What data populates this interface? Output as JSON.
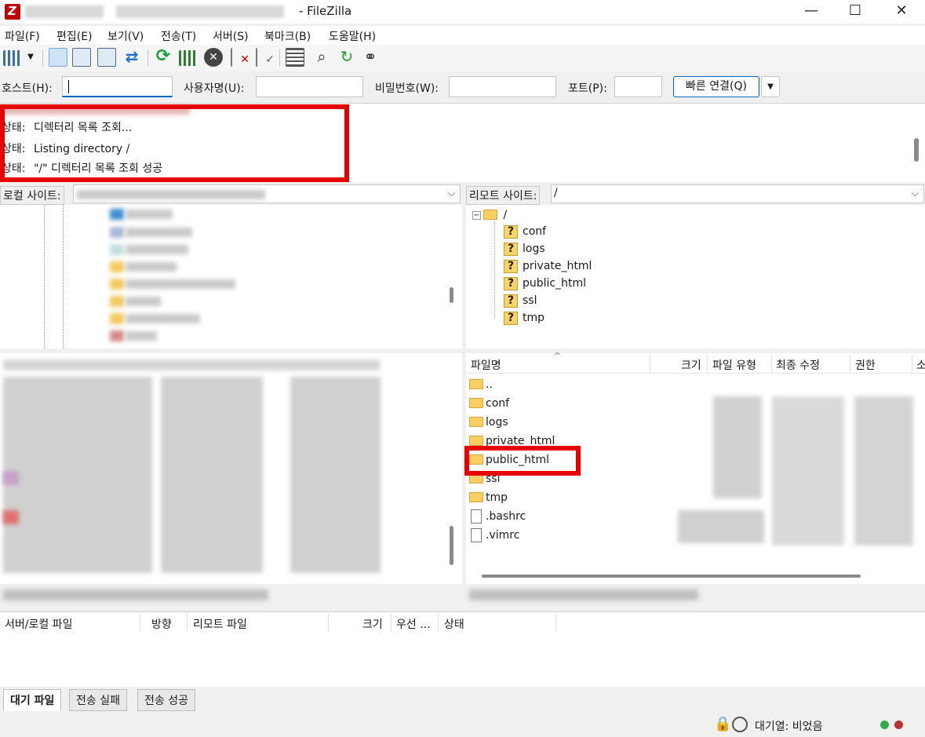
{
  "window": {
    "title": "- FileZilla",
    "controls": {
      "minimize": "—",
      "maximize": "☐",
      "close": "✕"
    }
  },
  "menu": [
    "파일(F)",
    "편집(E)",
    "보기(V)",
    "전송(T)",
    "서버(S)",
    "북마크(B)",
    "도움말(H)"
  ],
  "toolbar_icons": [
    "site-manager-icon",
    "dropdown-arrow-icon",
    "toggle-log-icon",
    "toggle-local-tree-icon",
    "toggle-remote-tree-icon",
    "toggle-queue-icon",
    "refresh-icon",
    "process-queue-icon",
    "cancel-icon",
    "disconnect-icon",
    "reconnect-icon",
    "directory-listing-filter-icon",
    "compare-icon",
    "sync-browse-icon",
    "search-icon"
  ],
  "quickconnect": {
    "host_label": "호스트(H):",
    "user_label": "사용자명(U):",
    "pass_label": "비밀번호(W):",
    "port_label": "포트(P):",
    "host_value": "",
    "user_value": "",
    "pass_value": "",
    "port_value": "",
    "connect_button": "빠른 연결(Q)",
    "dropdown": "▼"
  },
  "log": {
    "lines": [
      {
        "label": "상태:",
        "text": "디렉터리 목록 조회..."
      },
      {
        "label": "상태:",
        "text": "Listing directory /"
      },
      {
        "label": "상태:",
        "text": "\"/\" 디렉터리 목록 조회 성공"
      }
    ]
  },
  "local": {
    "site_label": "로컬 사이트:",
    "path": ""
  },
  "remote": {
    "site_label": "리모트 사이트:",
    "path": "/",
    "tree_root": "/",
    "tree_items": [
      "conf",
      "logs",
      "private_html",
      "public_html",
      "ssl",
      "tmp"
    ],
    "columns": [
      "파일명",
      "크기",
      "파일 유형",
      "최종 수정",
      "권한",
      "소"
    ],
    "files": [
      {
        "name": "..",
        "type": "folder"
      },
      {
        "name": "conf",
        "type": "folder"
      },
      {
        "name": "logs",
        "type": "folder"
      },
      {
        "name": "private_html",
        "type": "folder"
      },
      {
        "name": "public_html",
        "type": "folder"
      },
      {
        "name": "ssl",
        "type": "folder"
      },
      {
        "name": "tmp",
        "type": "folder"
      },
      {
        "name": ".bashrc",
        "type": "file"
      },
      {
        "name": ".vimrc",
        "type": "file"
      }
    ]
  },
  "queue": {
    "columns": [
      "서버/로컬 파일",
      "방향",
      "리모트 파일",
      "크기",
      "우선 ...",
      "상태"
    ],
    "tabs": [
      "대기 파일",
      "전송 실패",
      "전송 성공"
    ],
    "status": "대기열: 비었음"
  },
  "colors": {
    "highlight_red": "#e60000",
    "accent": "#0067c0"
  }
}
